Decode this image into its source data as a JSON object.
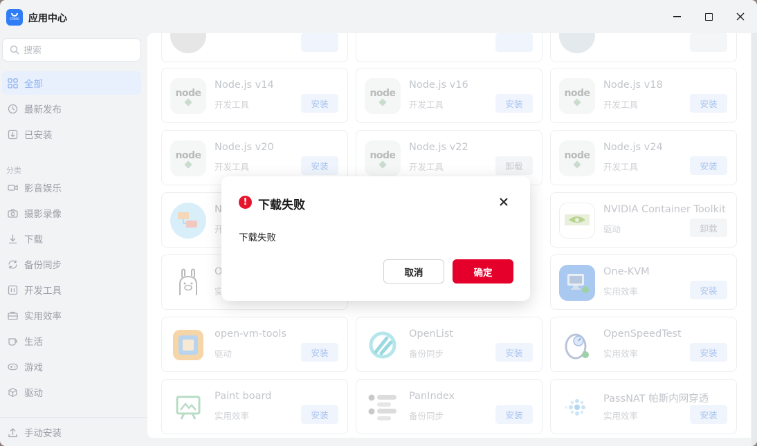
{
  "window": {
    "title": "应用中心",
    "logo_text": "STORE"
  },
  "search": {
    "placeholder": "搜索"
  },
  "sidebar": {
    "items": [
      {
        "label": "全部",
        "icon": "grid-icon",
        "active": true
      },
      {
        "label": "最新发布",
        "icon": "clock-icon"
      },
      {
        "label": "已安装",
        "icon": "download-box-icon"
      }
    ],
    "section_label": "分类",
    "categories": [
      {
        "label": "影音娱乐",
        "icon": "video-icon"
      },
      {
        "label": "摄影录像",
        "icon": "camera-icon"
      },
      {
        "label": "下载",
        "icon": "download-icon"
      },
      {
        "label": "备份同步",
        "icon": "sync-icon"
      },
      {
        "label": "开发工具",
        "icon": "code-icon"
      },
      {
        "label": "实用效率",
        "icon": "briefcase-icon"
      },
      {
        "label": "生活",
        "icon": "cup-icon"
      },
      {
        "label": "游戏",
        "icon": "gamepad-icon"
      },
      {
        "label": "驱动",
        "icon": "cube-icon"
      }
    ],
    "manual_install": "手动安装"
  },
  "apps": [
    {
      "name": "Node.js v14",
      "category": "开发工具",
      "action": "安装"
    },
    {
      "name": "Node.js v16",
      "category": "开发工具",
      "action": "安装"
    },
    {
      "name": "Node.js v18",
      "category": "开发工具",
      "action": "安装"
    },
    {
      "name": "Node.js v20",
      "category": "开发工具",
      "action": "安装"
    },
    {
      "name": "Node.js v22",
      "category": "开发工具",
      "action": "卸载"
    },
    {
      "name": "Node.js v24",
      "category": "开发工具",
      "action": "安装"
    },
    {
      "name": "N",
      "category": "开",
      "action": ""
    },
    {
      "name": "NVIDIA Container Toolkit",
      "category": "驱动",
      "action": "卸载"
    },
    {
      "name": "O",
      "category": "实",
      "action": ""
    },
    {
      "name": "One-KVM",
      "category": "实用效率",
      "action": "安装"
    },
    {
      "name": "open-vm-tools",
      "category": "驱动",
      "action": "安装"
    },
    {
      "name": "OpenList",
      "category": "备份同步",
      "action": "安装"
    },
    {
      "name": "OpenSpeedTest",
      "category": "实用效率",
      "action": "安装"
    },
    {
      "name": "Paint board",
      "category": "实用效率",
      "action": "安装"
    },
    {
      "name": "PanIndex",
      "category": "备份同步",
      "action": "安装"
    },
    {
      "name": "PassNAT 帕斯内网穿透",
      "category": "实用效率",
      "action": "安装"
    }
  ],
  "node_logo_text": "node",
  "dialog": {
    "title": "下载失败",
    "message": "下载失败",
    "cancel_label": "取消",
    "ok_label": "确定",
    "accent": "#e5002b"
  }
}
